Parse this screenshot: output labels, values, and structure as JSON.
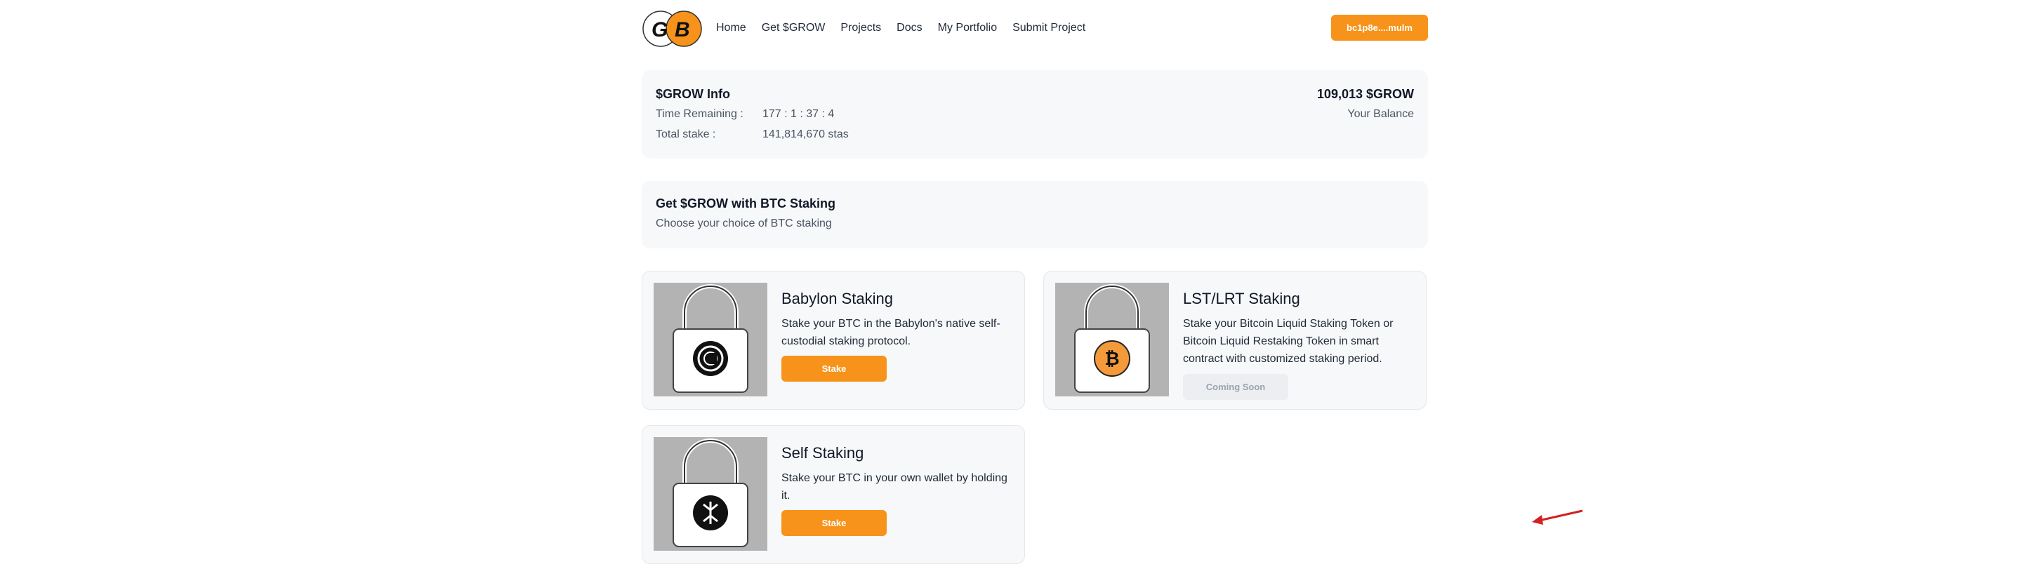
{
  "header": {
    "logo_text": "GB",
    "nav": [
      "Home",
      "Get $GROW",
      "Projects",
      "Docs",
      "My Portfolio",
      "Submit Project"
    ],
    "wallet_label": "bc1p8e....mulm"
  },
  "info": {
    "title": "$GROW Info",
    "time_label": "Time Remaining :",
    "time_value": "177 : 1 : 37 : 4",
    "stake_label": "Total stake :",
    "stake_value": "141,814,670 stas",
    "balance_value": "109,013 $GROW",
    "balance_label": "Your Balance"
  },
  "choose": {
    "title": "Get $GROW with BTC Staking",
    "subtitle": "Choose your choice of BTC staking"
  },
  "cards": [
    {
      "title": "Babylon Staking",
      "description": "Stake your BTC in the Babylon's native self-custodial staking protocol.",
      "button": "Stake",
      "icon": "babylon-icon"
    },
    {
      "title": "LST/LRT Staking",
      "description": "Stake your Bitcoin Liquid Staking Token or Bitcoin Liquid Restaking Token in smart contract with customized staking period.",
      "button": "Coming Soon",
      "icon": "bitcoin-icon"
    },
    {
      "title": "Self Staking",
      "description": "Stake your BTC in your own wallet by holding it.",
      "button": "Stake",
      "icon": "self-stake-icon"
    }
  ],
  "colors": {
    "accent": "#f7931a",
    "panel": "#f7f8fa",
    "annotation": "#d42020"
  }
}
